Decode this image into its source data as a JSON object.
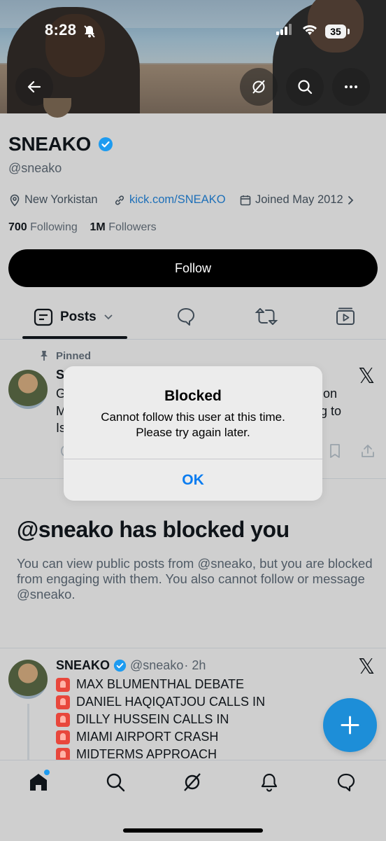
{
  "status_bar": {
    "time": "8:28",
    "battery": "35"
  },
  "profile": {
    "name": "SNEAKO",
    "handle": "@sneako",
    "location": "New Yorkistan",
    "link": "kick.com/SNEAKO",
    "joined": "Joined May 2012",
    "following_count": "700",
    "following_label": "Following",
    "followers_count": "1M",
    "followers_label": "Followers",
    "follow_button": "Follow"
  },
  "tabs": {
    "posts_label": "Posts"
  },
  "pinned_post": {
    "pinned_label": "Pinned",
    "line1_start": "S",
    "line2_start": "G",
    "line2_end": "on",
    "line3_start": "M",
    "line3_end": "g to",
    "line4_start": "Is"
  },
  "dialog": {
    "title": "Blocked",
    "message_line1": "Cannot follow this user at this time.",
    "message_line2": "Please try again later.",
    "ok_label": "OK"
  },
  "blocked_notice": {
    "title": "@sneako has blocked you",
    "description": "You can view public posts from @sneako, but you are blocked from engaging with them. You also cannot follow or message @sneako."
  },
  "post2": {
    "name": "SNEAKO",
    "handle": "@sneako",
    "time": "· 2h",
    "lines": [
      "MAX BLUMENTHAL DEBATE",
      "DANIEL HAQIQATJOU CALLS IN",
      "DILLY HUSSEIN CALLS IN",
      "MIAMI AIRPORT CRASH",
      "MIDTERMS APPROACH"
    ]
  },
  "colors": {
    "accent": "#1d9bf0",
    "dialog_button": "#0a7cf0",
    "verified": "#1d9bf0"
  }
}
